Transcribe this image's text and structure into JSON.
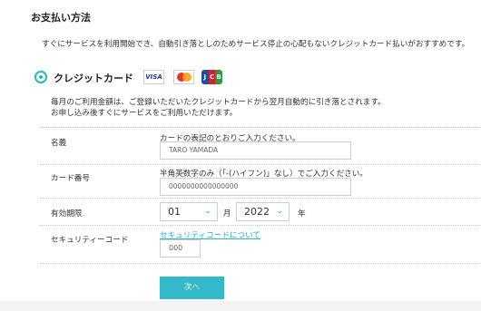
{
  "heading": "お支払い方法",
  "lead": "すぐにサービスを利用開始でき、自動引き落としのためサービス停止の心配もないクレジットカード払いがおすすめです。",
  "method": {
    "label": "クレジットカード",
    "selected": true,
    "accent": "#2ab5c8"
  },
  "brands": [
    "VISA",
    "Mastercard",
    "JCB"
  ],
  "notes": [
    "毎月のご利用金額は、ご登録いただいたクレジットカードから翌月自動的に引き落とされます。",
    "お申し込み後すぐにサービスをご利用いただけます。"
  ],
  "fields": {
    "name": {
      "label": "名義",
      "hint": "カードの表記のとおりご入力ください。",
      "value": "TARO YAMADA"
    },
    "number": {
      "label": "カード番号",
      "hint": "半角英数字のみ（「-(ハイフン)」なし）でご入力ください。",
      "value": "0000000000000000"
    },
    "expiry": {
      "label": "有効期限",
      "month": "01",
      "month_unit": "月",
      "year": "2022",
      "year_unit": "年"
    },
    "security": {
      "label": "セキュリティーコード",
      "link": "セキュリティコードについて",
      "value": "000"
    }
  },
  "submit_label": "次へ",
  "colors": {
    "accent": "#2ab5c8",
    "button": "#33b9c9"
  },
  "icons": {
    "dropdown": "chevron-down-icon",
    "visa": "visa-icon",
    "mastercard": "mastercard-icon",
    "jcb": "jcb-icon"
  }
}
